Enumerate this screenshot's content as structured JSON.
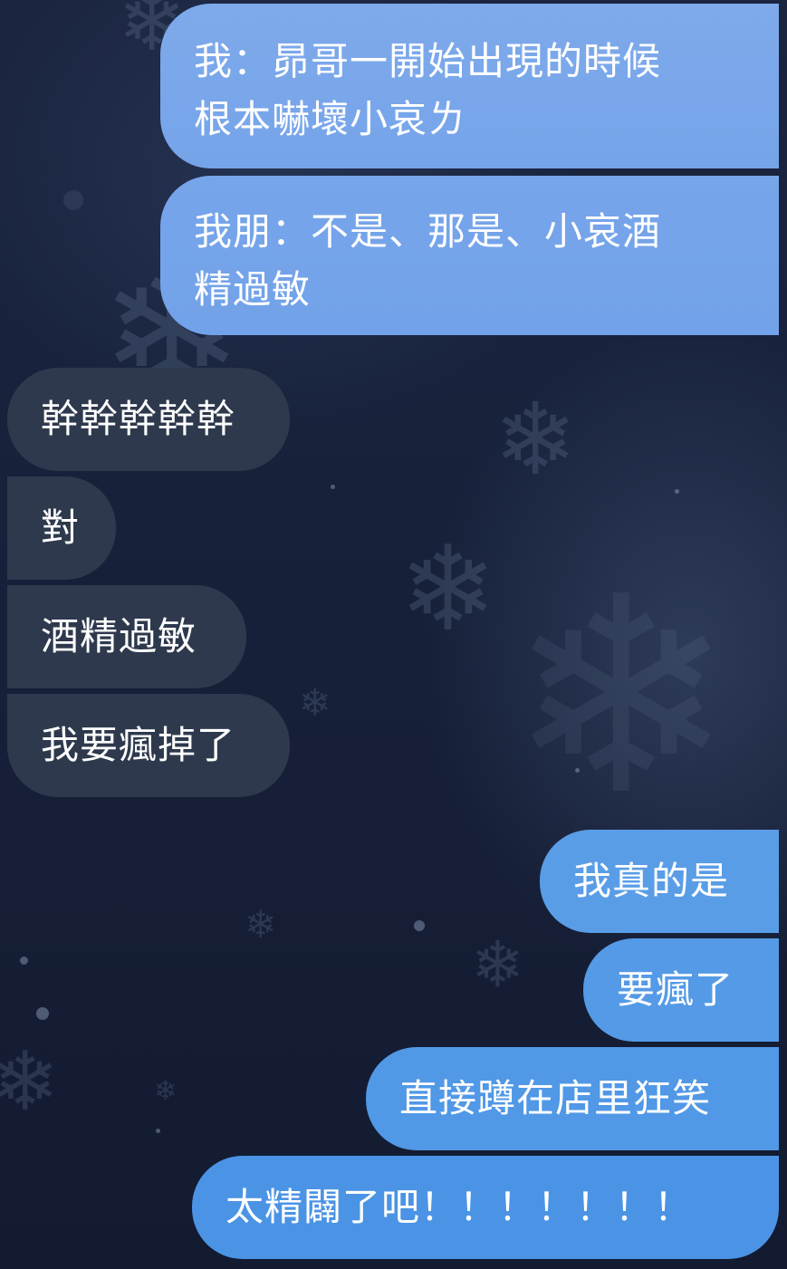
{
  "messages": [
    {
      "side": "outgoing",
      "lines": [
        "我：昴哥一開始出現的時候",
        "根本嚇壞小哀ㄌ"
      ]
    },
    {
      "side": "outgoing",
      "lines": [
        "我朋：不是、那是、小哀酒",
        "精過敏"
      ]
    },
    {
      "side": "incoming",
      "lines": [
        "幹幹幹幹幹"
      ]
    },
    {
      "side": "incoming",
      "lines": [
        "對"
      ]
    },
    {
      "side": "incoming",
      "lines": [
        "酒精過敏"
      ]
    },
    {
      "side": "incoming",
      "lines": [
        "我要瘋掉了"
      ]
    },
    {
      "side": "outgoing",
      "lines": [
        "我真的是"
      ]
    },
    {
      "side": "outgoing",
      "lines": [
        "要瘋了"
      ]
    },
    {
      "side": "outgoing",
      "lines": [
        "直接蹲在店里狂笑"
      ]
    },
    {
      "side": "outgoing",
      "lines": [
        "太精闢了吧！！！！！！！"
      ]
    }
  ],
  "colors": {
    "outgoing_bubble_top": "#7aa6e8",
    "outgoing_bubble_bottom": "#4e98e6",
    "incoming_bubble": "#2e394d",
    "background": "#17213a",
    "text": "#ffffff"
  }
}
